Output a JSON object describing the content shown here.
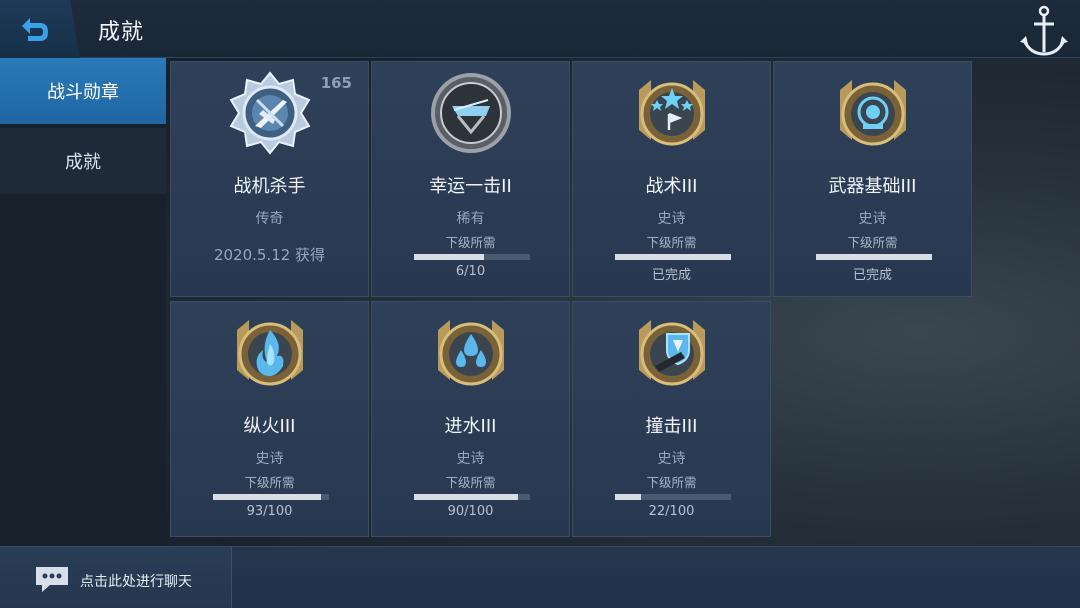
{
  "header": {
    "title": "成就"
  },
  "sidebar": {
    "tabs": [
      {
        "label": "战斗勋章"
      },
      {
        "label": "成就"
      }
    ]
  },
  "cards": [
    {
      "name": "战机杀手",
      "rarity": "传奇",
      "count": "165",
      "date": "2020.5.12 获得",
      "badge": "plane-badge-icon"
    },
    {
      "name": "幸运一击II",
      "rarity": "稀有",
      "req": "下级所需",
      "progress_text": "6/10",
      "progress": 0.6,
      "badge": "lucky-strike-badge-icon"
    },
    {
      "name": "战术III",
      "rarity": "史诗",
      "req": "下级所需",
      "progress_text": "已完成",
      "progress": 1.0,
      "badge": "tactics-badge-icon"
    },
    {
      "name": "武器基础III",
      "rarity": "史诗",
      "req": "下级所需",
      "progress_text": "已完成",
      "progress": 1.0,
      "badge": "weapon-basics-badge-icon"
    },
    {
      "name": "纵火III",
      "rarity": "史诗",
      "req": "下级所需",
      "progress_text": "93/100",
      "progress": 0.93,
      "badge": "fire-badge-icon"
    },
    {
      "name": "进水III",
      "rarity": "史诗",
      "req": "下级所需",
      "progress_text": "90/100",
      "progress": 0.9,
      "badge": "flooding-badge-icon"
    },
    {
      "name": "撞击III",
      "rarity": "史诗",
      "req": "下级所需",
      "progress_text": "22/100",
      "progress": 0.22,
      "badge": "ram-badge-icon"
    }
  ],
  "chat": {
    "placeholder": "点击此处进行聊天"
  },
  "colors": {
    "accent": "#2a7ab8",
    "card_bg": "#2f4059",
    "badge_gold": "#b89a5a",
    "badge_blue": "#5cc4f0"
  }
}
